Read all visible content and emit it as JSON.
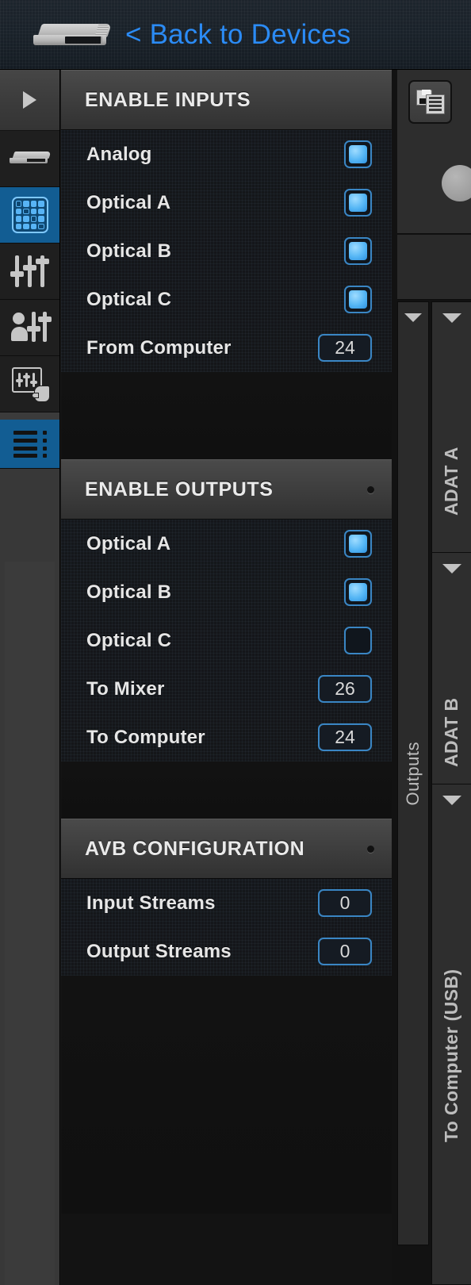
{
  "header": {
    "device_icon": "audio-interface-icon",
    "back_label": "< Back to Devices"
  },
  "sidebar": {
    "expand_icon": "triangle-right-icon",
    "items": [
      {
        "name": "device",
        "icon": "device-icon",
        "active": false
      },
      {
        "name": "routing",
        "icon": "routing-grid-icon",
        "active": true
      },
      {
        "name": "mixer",
        "icon": "faders-icon",
        "active": false
      },
      {
        "name": "personal-mixer",
        "icon": "person-faders-icon",
        "active": false
      },
      {
        "name": "touch-console",
        "icon": "touch-panel-icon",
        "active": false
      },
      {
        "name": "device-settings",
        "icon": "list-icon",
        "active": true
      }
    ]
  },
  "sections": [
    {
      "id": "enable-inputs",
      "title": "ENABLE INPUTS",
      "has_dot": false,
      "rows": [
        {
          "label": "Analog",
          "control": "checkbox",
          "checked": true
        },
        {
          "label": "Optical A",
          "control": "checkbox",
          "checked": true
        },
        {
          "label": "Optical B",
          "control": "checkbox",
          "checked": true
        },
        {
          "label": "Optical C",
          "control": "checkbox",
          "checked": true
        },
        {
          "label": "From Computer",
          "control": "number",
          "value": "24"
        }
      ]
    },
    {
      "id": "enable-outputs",
      "title": "ENABLE OUTPUTS",
      "has_dot": true,
      "rows": [
        {
          "label": "Optical A",
          "control": "checkbox",
          "checked": true
        },
        {
          "label": "Optical B",
          "control": "checkbox",
          "checked": true
        },
        {
          "label": "Optical C",
          "control": "checkbox",
          "checked": false
        },
        {
          "label": "To Mixer",
          "control": "number",
          "value": "26"
        },
        {
          "label": "To Computer",
          "control": "number",
          "value": "24"
        }
      ]
    },
    {
      "id": "avb-configuration",
      "title": "AVB CONFIGURATION",
      "has_dot": true,
      "rows": [
        {
          "label": "Input Streams",
          "control": "number",
          "value": "0"
        },
        {
          "label": "Output Streams",
          "control": "number",
          "value": "0"
        }
      ]
    }
  ],
  "right_panel": {
    "preset_icon": "save-preset-icon",
    "knob_icon": "knob-control",
    "outputs_label": "Outputs",
    "banks": [
      {
        "label": "ADAT A"
      },
      {
        "label": "ADAT B"
      },
      {
        "label": "To Computer (USB)"
      }
    ]
  },
  "colors": {
    "accent_blue": "#2b8bf5",
    "selection_blue": "#125d93",
    "checkbox_border": "#3a86c4",
    "checkbox_fill": "#55b6f5",
    "panel_dark": "#14171b",
    "header_gray": "#3f3f3f"
  }
}
